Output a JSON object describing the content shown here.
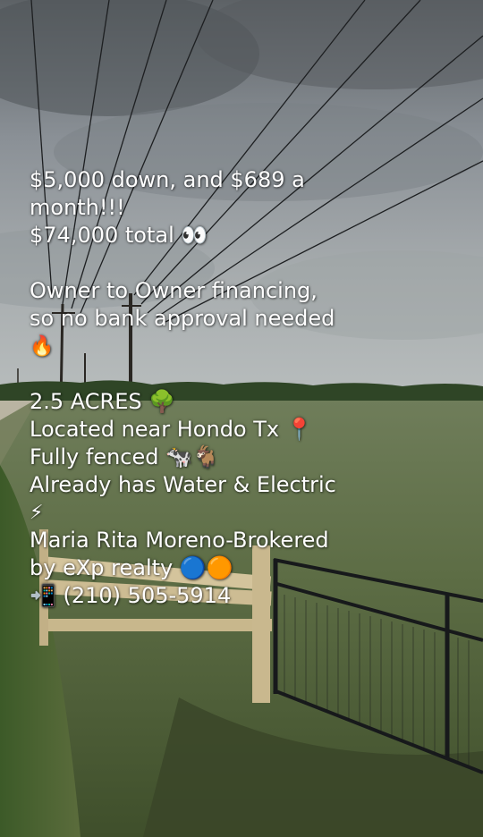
{
  "caption": {
    "line1": "$5,000 down, and $689 a",
    "line2": "month!!!",
    "line3": "$74,000 total 👀",
    "line4": "Owner to Owner financing,",
    "line5": "so no bank approval needed",
    "line6": "🔥",
    "line7": "2.5 ACRES 🌳",
    "line8": "Located near Hondo Tx 📍",
    "line9": "Fully fenced 🐄🐐",
    "line10": "Already has Water & Electric",
    "line11": "⚡",
    "line12": "Maria Rita Moreno-Brokered",
    "line13": "by eXp realty 🔵🟠",
    "line14": "📲 (210) 505-5914"
  }
}
